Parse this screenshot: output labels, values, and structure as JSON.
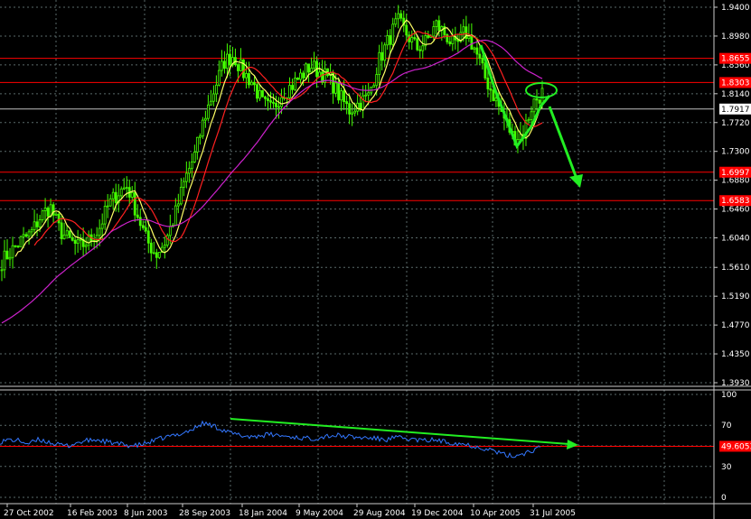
{
  "colors": {
    "background": "#000000",
    "grid": "#5a6a6a",
    "candles": "#44ff00",
    "ma_fast": "#ffff66",
    "ma_mid": "#ff2020",
    "ma_slow": "#cc22cc",
    "level_line": "#ff0000",
    "price_line": "#c0c0c0",
    "annotation": "#22ee22",
    "oscillator": "#3377ff",
    "axis_text": "#ffffff"
  },
  "chart_data": [
    {
      "type": "candlestick",
      "title": "",
      "ylim": [
        1.37,
        1.945
      ],
      "y_ticks": [
        "1.9400",
        "1.8980",
        "1.8560",
        "1.8140",
        "1.7720",
        "1.7300",
        "1.6880",
        "1.6460",
        "1.6040",
        "1.5610",
        "1.5190",
        "1.4770",
        "1.4350",
        "1.3930"
      ],
      "x_ticks": [
        "27 Oct 2002",
        "16 Feb 2003",
        "8 Jun 2003",
        "28 Sep 2003",
        "18 Jan 2004",
        "9 May 2004",
        "29 Aug 2004",
        "19 Dec 2004",
        "10 Apr 2005",
        "31 Jul 2005"
      ],
      "current_price": "1.7917",
      "horizontal_levels": [
        {
          "label": "1.8655",
          "value": 1.8655
        },
        {
          "label": "1.8303",
          "value": 1.8303
        },
        {
          "label": "1.6997",
          "value": 1.6997
        },
        {
          "label": "1.6583",
          "value": 1.6583
        }
      ],
      "series": [
        {
          "key": "price",
          "values": [
            1.57,
            1.585,
            1.6,
            1.61,
            1.635,
            1.65,
            1.615,
            1.6,
            1.59,
            1.6,
            1.615,
            1.65,
            1.67,
            1.68,
            1.64,
            1.6,
            1.58,
            1.6,
            1.64,
            1.69,
            1.725,
            1.78,
            1.82,
            1.86,
            1.87,
            1.845,
            1.83,
            1.8,
            1.79,
            1.815,
            1.825,
            1.84,
            1.855,
            1.845,
            1.835,
            1.81,
            1.79,
            1.8,
            1.81,
            1.86,
            1.89,
            1.92,
            1.9,
            1.88,
            1.89,
            1.915,
            1.9,
            1.88,
            1.905,
            1.88,
            1.84,
            1.81,
            1.78,
            1.75,
            1.755,
            1.8,
            1.815
          ]
        }
      ]
    },
    {
      "type": "line",
      "title": "",
      "ylim": [
        0,
        100
      ],
      "y_ticks": [
        "100",
        "70",
        "50",
        "30",
        "0"
      ],
      "current_value": "49.6053",
      "level": 49.6053,
      "series": [
        {
          "key": "oscillator",
          "values": [
            54,
            56,
            55,
            52,
            56,
            54,
            51,
            50,
            53,
            55,
            56,
            54,
            52,
            51,
            50,
            52,
            55,
            58,
            60,
            63,
            66,
            72,
            70,
            66,
            62,
            60,
            59,
            60,
            61,
            60,
            59,
            58,
            57,
            58,
            60,
            60,
            59,
            58,
            58,
            57,
            56,
            58,
            57,
            56,
            55,
            56,
            54,
            53,
            52,
            50,
            48,
            46,
            42,
            40,
            42,
            45,
            48
          ]
        }
      ]
    }
  ]
}
